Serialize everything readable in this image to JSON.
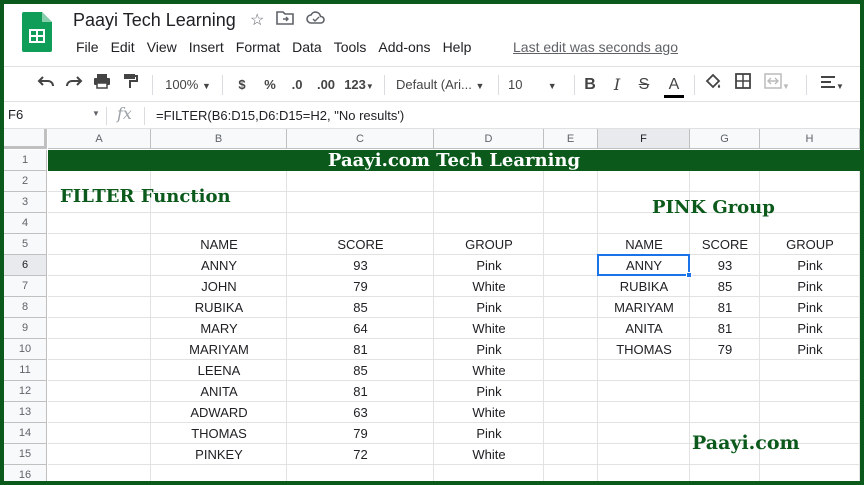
{
  "app": {
    "title": "Paayi Tech Learning",
    "menu": [
      "File",
      "Edit",
      "View",
      "Insert",
      "Format",
      "Data",
      "Tools",
      "Add-ons",
      "Help"
    ],
    "last_edit": "Last edit was seconds ago"
  },
  "toolbar": {
    "zoom": "100%",
    "currency": "$",
    "percent": "%",
    "dec_decrease": ".0",
    "dec_increase": ".00",
    "more_formats": "123",
    "font": "Default (Ari...",
    "font_size": "10"
  },
  "formula_bar": {
    "name_box": "F6",
    "fx": "fx",
    "formula": "=FILTER(B6:D15,D6:D15=H2, \"No results')"
  },
  "columns": [
    "A",
    "B",
    "C",
    "D",
    "E",
    "F",
    "G",
    "H"
  ],
  "rows": [
    "1",
    "2",
    "3",
    "4",
    "5",
    "6",
    "7",
    "8",
    "9",
    "10",
    "11",
    "12",
    "13",
    "14",
    "15",
    "16"
  ],
  "sheet": {
    "banner": "Paayi.com Tech Learning",
    "left_heading": "FILTER Function",
    "right_heading": "PINK Group",
    "footer_brand": "Paayi.com",
    "headers": {
      "name": "NAME",
      "score": "SCORE",
      "group": "GROUP"
    },
    "source": [
      {
        "name": "ANNY",
        "score": "93",
        "group": "Pink"
      },
      {
        "name": "JOHN",
        "score": "79",
        "group": "White"
      },
      {
        "name": "RUBIKA",
        "score": "85",
        "group": "Pink"
      },
      {
        "name": "MARY",
        "score": "64",
        "group": "White"
      },
      {
        "name": "MARIYAM",
        "score": "81",
        "group": "Pink"
      },
      {
        "name": "LEENA",
        "score": "85",
        "group": "White"
      },
      {
        "name": "ANITA",
        "score": "81",
        "group": "Pink"
      },
      {
        "name": "ADWARD",
        "score": "63",
        "group": "White"
      },
      {
        "name": "THOMAS",
        "score": "79",
        "group": "Pink"
      },
      {
        "name": "PINKEY",
        "score": "72",
        "group": "White"
      }
    ],
    "result": [
      {
        "name": "ANNY",
        "score": "93",
        "group": "Pink"
      },
      {
        "name": "RUBIKA",
        "score": "85",
        "group": "Pink"
      },
      {
        "name": "MARIYAM",
        "score": "81",
        "group": "Pink"
      },
      {
        "name": "ANITA",
        "score": "81",
        "group": "Pink"
      },
      {
        "name": "THOMAS",
        "score": "79",
        "group": "Pink"
      }
    ]
  },
  "colors": {
    "brand_green": "#0b5a1b",
    "selection": "#1a73e8"
  }
}
